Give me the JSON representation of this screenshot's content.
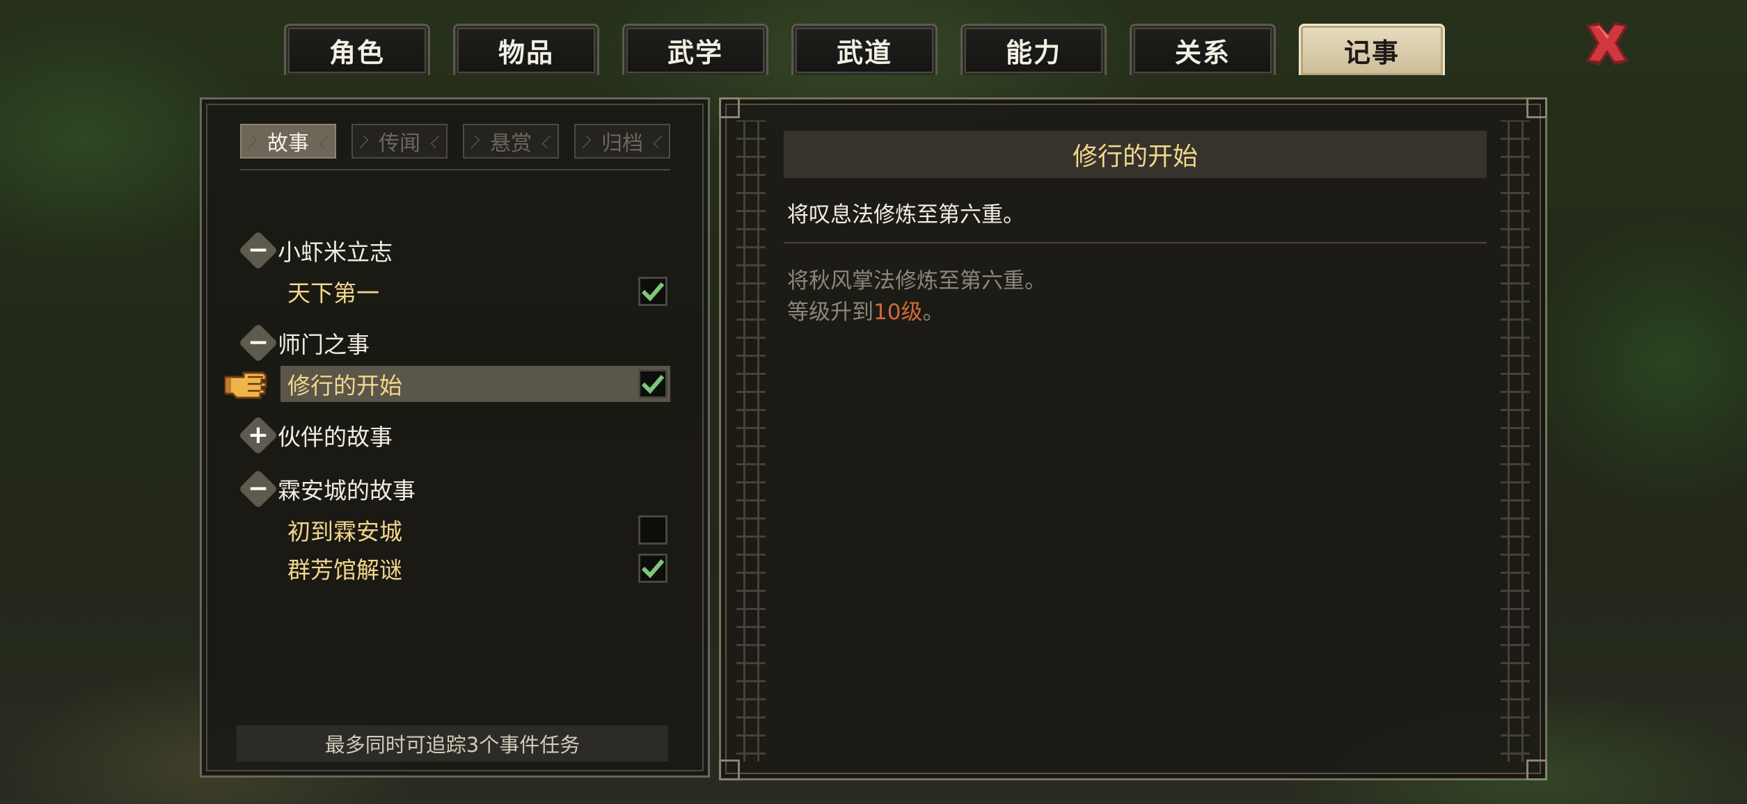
{
  "tabs": [
    {
      "label": "角色"
    },
    {
      "label": "物品"
    },
    {
      "label": "武学"
    },
    {
      "label": "武道"
    },
    {
      "label": "能力"
    },
    {
      "label": "关系"
    },
    {
      "label": "记事",
      "active": true
    }
  ],
  "subtabs": [
    {
      "label": "故事",
      "active": true
    },
    {
      "label": "传闻"
    },
    {
      "label": "悬赏"
    },
    {
      "label": "归档"
    }
  ],
  "groups": [
    {
      "title": "小虾米立志",
      "toggle": "−",
      "expanded": true,
      "quests": [
        {
          "label": "天下第一",
          "checked": true
        }
      ]
    },
    {
      "title": "师门之事",
      "toggle": "−",
      "expanded": true,
      "quests": [
        {
          "label": "修行的开始",
          "checked": true,
          "selected": true
        }
      ]
    },
    {
      "title": "伙伴的故事",
      "toggle": "+",
      "expanded": false,
      "quests": []
    },
    {
      "title": "霖安城的故事",
      "toggle": "−",
      "expanded": true,
      "quests": [
        {
          "label": "初到霖安城",
          "checked": false
        },
        {
          "label": "群芳馆解谜",
          "checked": true
        }
      ]
    }
  ],
  "track_note": "最多同时可追踪3个事件任务",
  "detail": {
    "title": "修行的开始",
    "objective": "将叹息法修炼至第六重。",
    "completed": [
      {
        "text": "将秋风掌法修炼至第六重。"
      },
      {
        "prefix": "等级升到",
        "highlight": "10级",
        "suffix": "。"
      }
    ]
  },
  "colors": {
    "gold_text": "#f3d68c",
    "active_tab": "#e8dcc0",
    "check_green": "#7dc97a",
    "highlight_orange": "#d16a3a",
    "close_red": "#c9343a"
  },
  "icons": {
    "close": "close-x-icon",
    "pointer": "pointing-hand-icon",
    "check": "checkmark-icon"
  }
}
